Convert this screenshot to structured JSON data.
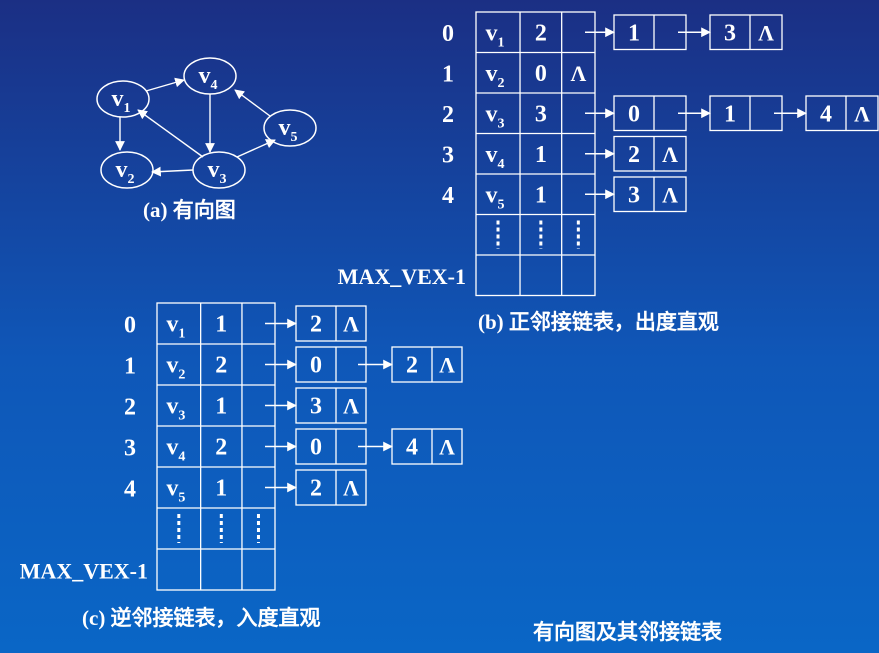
{
  "graph": {
    "vertices": [
      {
        "name": "v",
        "sub": "1"
      },
      {
        "name": "v",
        "sub": "4"
      },
      {
        "name": "v",
        "sub": "5"
      },
      {
        "name": "v",
        "sub": "2"
      },
      {
        "name": "v",
        "sub": "3"
      }
    ],
    "caption": "(a)  有向图"
  },
  "out_list": {
    "indices": [
      "0",
      "1",
      "2",
      "3",
      "4"
    ],
    "max_label": "MAX_VEX-1",
    "rows": [
      {
        "v": "v",
        "sub": "1",
        "count": "2",
        "end": "",
        "nodes": [
          {
            "val": "1",
            "last": false
          },
          {
            "val": "3",
            "last": true
          }
        ]
      },
      {
        "v": "v",
        "sub": "2",
        "count": "0",
        "end": "Λ",
        "nodes": []
      },
      {
        "v": "v",
        "sub": "3",
        "count": "3",
        "end": "",
        "nodes": [
          {
            "val": "0",
            "last": false
          },
          {
            "val": "1",
            "last": false
          },
          {
            "val": "4",
            "last": true
          }
        ]
      },
      {
        "v": "v",
        "sub": "4",
        "count": "1",
        "end": "",
        "nodes": [
          {
            "val": "2",
            "last": true
          }
        ]
      },
      {
        "v": "v",
        "sub": "5",
        "count": "1",
        "end": "",
        "nodes": [
          {
            "val": "3",
            "last": true
          }
        ]
      }
    ],
    "caption": "(b)  正邻接链表，出度直观"
  },
  "in_list": {
    "indices": [
      "0",
      "1",
      "2",
      "3",
      "4"
    ],
    "max_label": "MAX_VEX-1",
    "rows": [
      {
        "v": "v",
        "sub": "1",
        "count": "1",
        "end": "",
        "nodes": [
          {
            "val": "2",
            "last": true
          }
        ]
      },
      {
        "v": "v",
        "sub": "2",
        "count": "2",
        "end": "",
        "nodes": [
          {
            "val": "0",
            "last": false
          },
          {
            "val": "2",
            "last": true
          }
        ]
      },
      {
        "v": "v",
        "sub": "3",
        "count": "1",
        "end": "",
        "nodes": [
          {
            "val": "3",
            "last": true
          }
        ]
      },
      {
        "v": "v",
        "sub": "4",
        "count": "2",
        "end": "",
        "nodes": [
          {
            "val": "0",
            "last": false
          },
          {
            "val": "4",
            "last": true
          }
        ]
      },
      {
        "v": "v",
        "sub": "5",
        "count": "1",
        "end": "",
        "nodes": [
          {
            "val": "2",
            "last": true
          }
        ]
      }
    ],
    "caption": "(c)  逆邻接链表，入度直观"
  },
  "null_symbol": "Λ",
  "footer_title": "有向图及其邻接链表",
  "colors": {
    "stroke": "#ffffff",
    "text": "#ffffff"
  }
}
